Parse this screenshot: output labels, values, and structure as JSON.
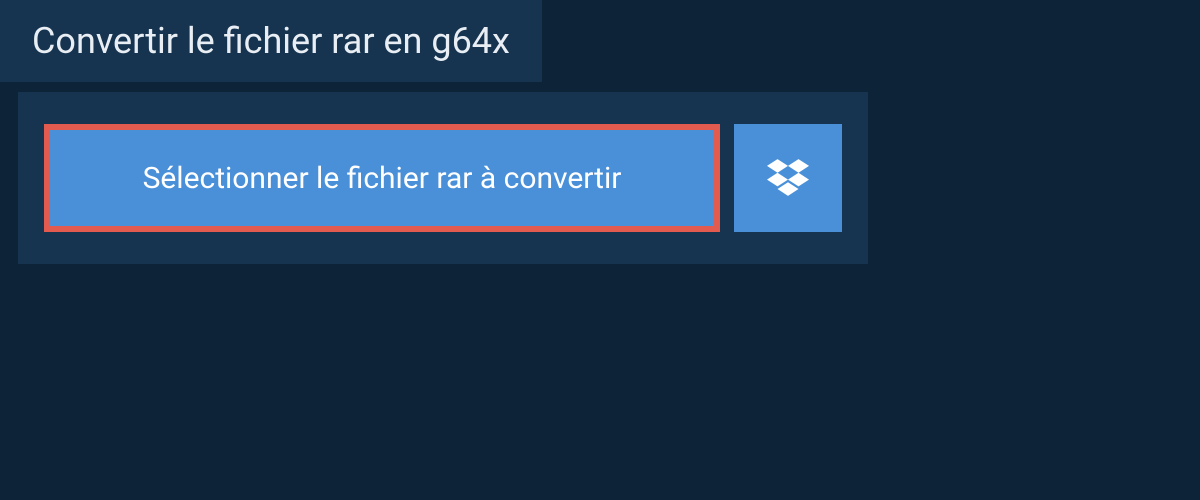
{
  "header": {
    "title": "Convertir le fichier rar en g64x"
  },
  "actions": {
    "select_file_label": "Sélectionner le fichier rar à convertir"
  },
  "colors": {
    "background": "#0d2438",
    "panel": "#163450",
    "button": "#4a90d9",
    "highlight_border": "#e35a4f",
    "text_light": "#e8eef3",
    "text_white": "#ffffff"
  }
}
